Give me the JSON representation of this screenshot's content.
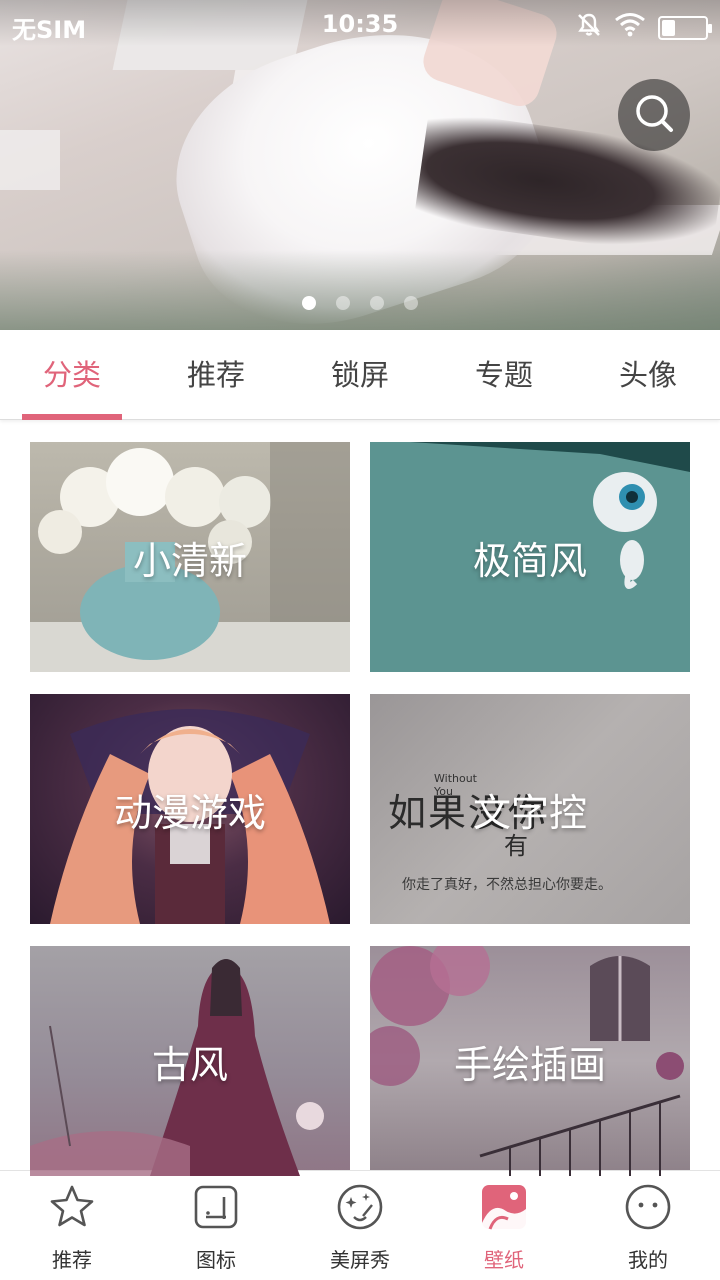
{
  "status_bar": {
    "carrier": "无SIM",
    "time": "10:35",
    "battery_level": 0.3
  },
  "banner": {
    "slide_count": 4,
    "active_slide": 1
  },
  "tabs": {
    "items": [
      {
        "label": "分类",
        "active": true
      },
      {
        "label": "推荐",
        "active": false
      },
      {
        "label": "锁屏",
        "active": false
      },
      {
        "label": "专题",
        "active": false
      },
      {
        "label": "头像",
        "active": false
      }
    ]
  },
  "categories": [
    {
      "label": "小清新"
    },
    {
      "label": "极简风"
    },
    {
      "label": "动漫游戏"
    },
    {
      "label": "文字控",
      "image_text": {
        "line1": "如果没你",
        "line2": "Without You",
        "line3": "有",
        "line4": "你走了真好，不然总担心你要走。"
      }
    },
    {
      "label": "古风"
    },
    {
      "label": "手绘插画"
    }
  ],
  "bottom_nav": {
    "items": [
      {
        "label": "推荐",
        "icon": "star-icon",
        "active": false
      },
      {
        "label": "图标",
        "icon": "icon-grid-icon",
        "active": false
      },
      {
        "label": "美屏秀",
        "icon": "sparkle-face-icon",
        "active": false
      },
      {
        "label": "壁纸",
        "icon": "wallpaper-icon",
        "active": true
      },
      {
        "label": "我的",
        "icon": "smiley-icon",
        "active": false
      }
    ]
  },
  "colors": {
    "accent": "#e0647a",
    "tab_text": "#444444",
    "nav_text": "#333333"
  }
}
